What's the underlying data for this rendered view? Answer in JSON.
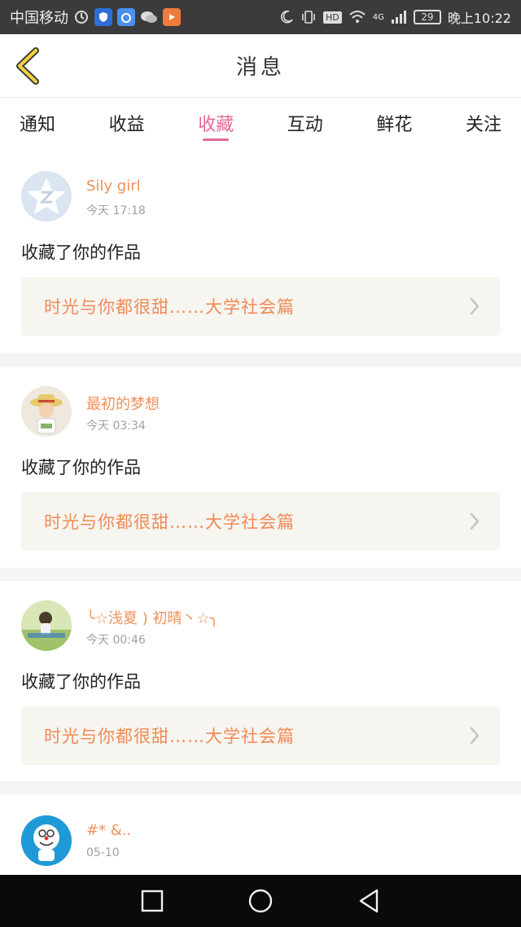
{
  "status_bar": {
    "carrier": "中国移动",
    "hd_label": "HD",
    "network": "4G",
    "battery": "29",
    "time": "晚上10:22"
  },
  "header": {
    "title": "消息"
  },
  "tabs": [
    {
      "label": "通知",
      "active": false
    },
    {
      "label": "收益",
      "active": false
    },
    {
      "label": "收藏",
      "active": true
    },
    {
      "label": "互动",
      "active": false
    },
    {
      "label": "鲜花",
      "active": false
    },
    {
      "label": "关注",
      "active": false
    }
  ],
  "messages": [
    {
      "username": "Sily girl",
      "time": "今天 17:18",
      "action": "收藏了你的作品",
      "work_title": "时光与你都很甜……大学社会篇"
    },
    {
      "username": "最初的梦想",
      "time": "今天 03:34",
      "action": "收藏了你的作品",
      "work_title": "时光与你都很甜……大学社会篇"
    },
    {
      "username": "╰☆浅夏 ) 初晴丶☆╮",
      "time": "今天 00:46",
      "action": "收藏了你的作品",
      "work_title": "时光与你都很甜……大学社会篇"
    },
    {
      "username": "#* &..",
      "time": "05-10"
    }
  ],
  "colors": {
    "accent": "#e5699c",
    "username": "#f0905a",
    "work_title": "#f08a55",
    "link_bg": "#f6f5f0"
  },
  "icons": {
    "back": "chevron-left-icon",
    "chevron": "chevron-right-icon",
    "nav": [
      "square-icon",
      "circle-icon",
      "triangle-back-icon"
    ]
  }
}
